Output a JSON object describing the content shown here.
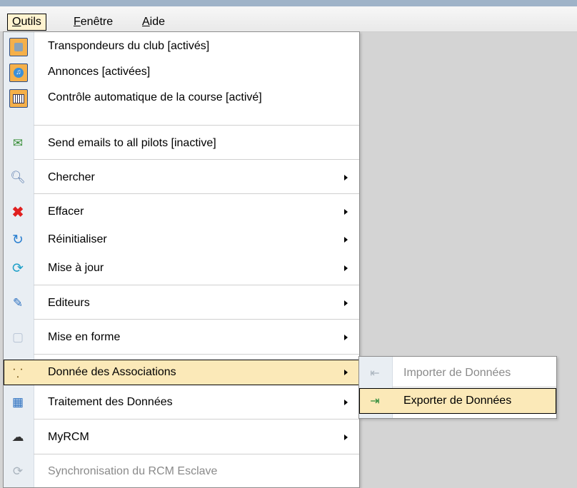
{
  "menubar": {
    "items": [
      {
        "mnemonic": "O",
        "rest": "utils"
      },
      {
        "mnemonic": "F",
        "rest": "enêtre"
      },
      {
        "mnemonic": "A",
        "rest": "ide"
      }
    ]
  },
  "dropdown": {
    "items": [
      {
        "label": "Transpondeurs du club [activés]",
        "icon": "transponder-icon"
      },
      {
        "label": "Annonces [activées]",
        "icon": "music-note-icon"
      },
      {
        "label": "Contrôle automatique de la course [activé]",
        "icon": "calculator-icon"
      },
      {
        "label": "Send emails to all pilots [inactive]",
        "icon": "email-send-icon"
      },
      {
        "label": "Chercher",
        "icon": "magnifier-icon"
      },
      {
        "label": "Effacer",
        "icon": "red-x-icon"
      },
      {
        "label": "Réinitialiser",
        "icon": "reset-icon"
      },
      {
        "label": "Mise à jour",
        "icon": "refresh-icon"
      },
      {
        "label": "Editeurs",
        "icon": "editor-icon"
      },
      {
        "label": "Mise en forme",
        "icon": "format-icon"
      },
      {
        "label": "Donnée des Associations",
        "icon": "hierarchy-icon"
      },
      {
        "label": "Traitement des Données",
        "icon": "data-processing-icon"
      },
      {
        "label": "MyRCM",
        "icon": "cloud-icon"
      },
      {
        "label": "Synchronisation du RCM Esclave",
        "icon": "sync-icon"
      }
    ]
  },
  "submenu": {
    "items": [
      {
        "label": "Importer de Données",
        "icon": "import-icon"
      },
      {
        "label": "Exporter de Données",
        "icon": "export-icon"
      }
    ]
  },
  "colors": {
    "highlight": "#fbe9b8",
    "menubar_active": "#fff3d0",
    "disabled_text": "#8a8a8a",
    "icon_column": "#e9eef3"
  }
}
